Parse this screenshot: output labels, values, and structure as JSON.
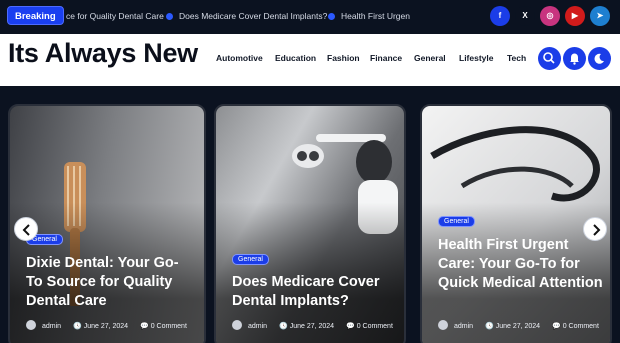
{
  "topbar": {
    "breaking_label": "Breaking",
    "ticker": [
      "Dixie Dental: Your Go-To Source for Quality Dental Care",
      "Does Medicare Cover Dental Implants?",
      "Health First Urgent Care: Your Go-To for Quick Medical Attention"
    ],
    "ticker_visible": [
      "ce for Quality Dental Care",
      "Does Medicare Cover Dental Implants?",
      "Health First Urgen"
    ],
    "socials": [
      {
        "icon": "facebook-icon",
        "glyph": "f",
        "color": "#1b3de8"
      },
      {
        "icon": "x-icon",
        "glyph": "𝕏",
        "color": "#0b1220"
      },
      {
        "icon": "instagram-icon",
        "glyph": "◎",
        "color": "#c8347f"
      },
      {
        "icon": "youtube-icon",
        "glyph": "▶",
        "color": "#d11b1b"
      },
      {
        "icon": "telegram-icon",
        "glyph": "➤",
        "color": "#1e7fd0"
      }
    ]
  },
  "header": {
    "logo": "Its Always New",
    "nav": [
      "Automotive",
      "Education",
      "Fashion",
      "Finance",
      "General",
      "Lifestyle",
      "Tech"
    ],
    "buttons": [
      "search-icon",
      "bell-icon",
      "moon-icon"
    ]
  },
  "posts": [
    {
      "category": "General",
      "title": "Dixie Dental: Your Go-To Source for Quality Dental Care",
      "author": "admin",
      "date": "June 27, 2024",
      "comments": "0 Comment"
    },
    {
      "category": "General",
      "title": "Does Medicare Cover Dental Implants?",
      "author": "admin",
      "date": "June 27, 2024",
      "comments": "0 Comment"
    },
    {
      "category": "General",
      "title": "Health First Urgent Care: Your Go-To for Quick Medical Attention",
      "author": "admin",
      "date": "June 27, 2024",
      "comments": "0 Comment"
    }
  ],
  "colors": {
    "accent": "#1b3de8",
    "dark": "#0b1220"
  }
}
